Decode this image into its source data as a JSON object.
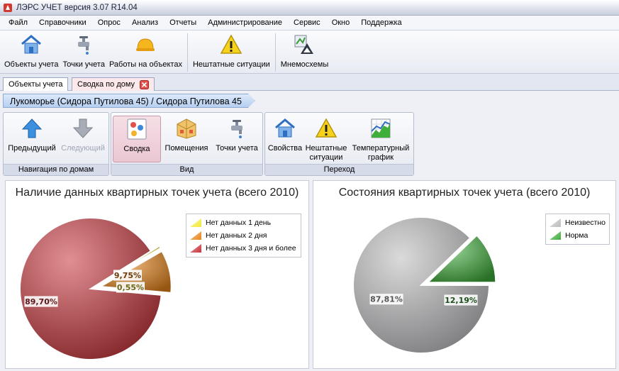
{
  "window": {
    "title": "ЛЭРС УЧЕТ версия 3.07 R14.04"
  },
  "menu": [
    "Файл",
    "Справочники",
    "Опрос",
    "Анализ",
    "Отчеты",
    "Администрирование",
    "Сервис",
    "Окно",
    "Поддержка"
  ],
  "toolbar": {
    "objects": "Объекты учета",
    "points": "Точки учета",
    "works": "Работы на объектах",
    "emergencies": "Нештатные ситуации",
    "mnemo": "Мнемосхемы"
  },
  "tabs": {
    "objects": "Объекты учета",
    "summary": "Сводка по дому"
  },
  "breadcrumb": "Лукоморье (Сидора Путилова 45) / Сидора Путилова 45",
  "ribbon": {
    "nav": {
      "caption": "Навигация по домам",
      "prev": "Предыдущий",
      "next": "Следующий"
    },
    "view": {
      "caption": "Вид",
      "summary": "Сводка",
      "rooms": "Помещения",
      "points": "Точки учета"
    },
    "goto": {
      "caption": "Переход",
      "props": "Свойства",
      "emerg1": "Нештатные",
      "emerg2": "ситуации",
      "temp1": "Температурный",
      "temp2": "график"
    }
  },
  "charts": {
    "left": {
      "title": "Наличие данных квартирных точек учета (всего 2010)"
    },
    "right": {
      "title": "Состояния квартирных точек учета (всего 2010)"
    }
  },
  "chart_data": [
    {
      "type": "pie",
      "title": "Наличие данных квартирных точек учета (всего 2010)",
      "legend_position": "top-right",
      "series": [
        {
          "name": "Нет данных 1 день",
          "value": 0.55,
          "label": "0,55%",
          "color": "#f2ea3a"
        },
        {
          "name": "Нет данных 2 дня",
          "value": 9.75,
          "label": "9,75%",
          "color": "#e8861c"
        },
        {
          "name": "Нет данных 3 дня и более",
          "value": 89.7,
          "label": "89,70%",
          "color": "#c7343a"
        }
      ]
    },
    {
      "type": "pie",
      "title": "Состояния квартирных точек учета (всего 2010)",
      "legend_position": "top-right",
      "series": [
        {
          "name": "Неизвестно",
          "value": 87.81,
          "label": "87,81%",
          "color": "#bdbcbe"
        },
        {
          "name": "Норма",
          "value": 12.19,
          "label": "12,19%",
          "color": "#3fae3b"
        }
      ]
    }
  ]
}
